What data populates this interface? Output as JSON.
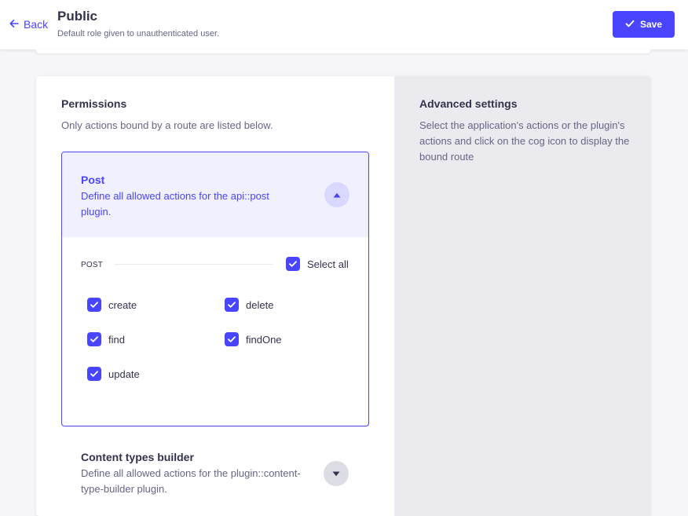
{
  "header": {
    "back_label": "Back",
    "title": "Public",
    "subtitle": "Default role given to unauthenticated user.",
    "save_label": "Save"
  },
  "permissions": {
    "title": "Permissions",
    "description": "Only actions bound by a route are listed below."
  },
  "advanced": {
    "title": "Advanced settings",
    "description": "Select the application's actions or the plugin's actions and click on the cog icon to display the bound route"
  },
  "accordions": [
    {
      "title": "Post",
      "description": "Define all allowed actions for the api::post plugin.",
      "expanded": true,
      "group_label": "POST",
      "select_all_label": "Select all",
      "select_all_checked": true,
      "actions": [
        {
          "label": "create",
          "checked": true
        },
        {
          "label": "delete",
          "checked": true
        },
        {
          "label": "find",
          "checked": true
        },
        {
          "label": "findOne",
          "checked": true
        },
        {
          "label": "update",
          "checked": true
        }
      ]
    },
    {
      "title": "Content types builder",
      "description": "Define all allowed actions for the plugin::content-type-builder plugin.",
      "expanded": false
    }
  ],
  "colors": {
    "primary": "#4945ff",
    "primary_light": "#f0f0ff",
    "panel": "#eaeaef",
    "text": "#32324d",
    "muted": "#666687"
  },
  "icons": {
    "back": "arrow-left-icon",
    "save": "check-icon",
    "collapse": "chevron-up-icon",
    "expand": "chevron-down-icon",
    "checkbox": "checkmark-icon"
  }
}
